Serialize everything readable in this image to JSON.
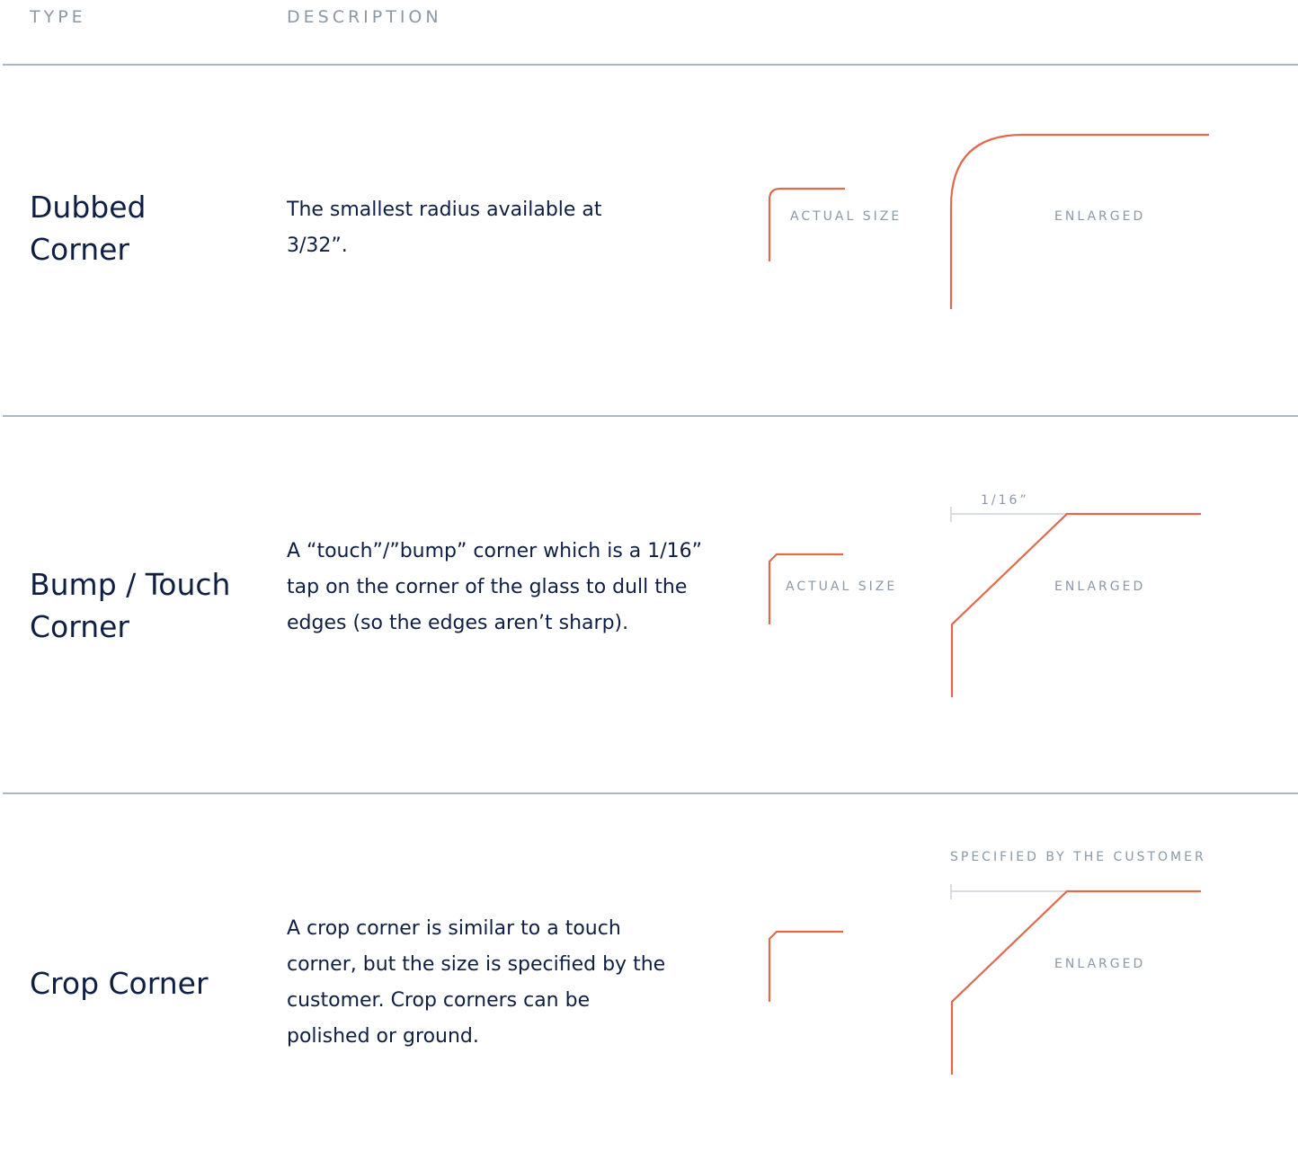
{
  "header": {
    "type_label": "TYPE",
    "description_label": "DESCRIPTION"
  },
  "rows": [
    {
      "name_line1": "Dubbed",
      "name_line2": "Corner",
      "description": "The smallest radius available at 3/32”.",
      "actual_size_label": "ACTUAL SIZE",
      "enlarged_label": "ENLARGED"
    },
    {
      "name_line1": "Bump / Touch",
      "name_line2": "Corner",
      "description": "A “touch”/”bump” corner which is a 1/16” tap on the corner of the glass to dull the edges (so the edges aren’t sharp).",
      "actual_size_label": "ACTUAL SIZE",
      "enlarged_label": "ENLARGED",
      "dimension_label": "1/16”"
    },
    {
      "name_line1": "Crop Corner",
      "description": "A crop corner is similar to a touch corner, but the size is specified by the customer. Crop corners can be polished or ground.",
      "enlarged_label": "ENLARGED",
      "dimension_label": "SPECIFIED BY THE CUSTOMER"
    }
  ],
  "colors": {
    "corner_line": "#e06a4e",
    "heading_text": "#0f1f44",
    "label_text": "#8a98a8",
    "divider": "#a9b8c8"
  }
}
